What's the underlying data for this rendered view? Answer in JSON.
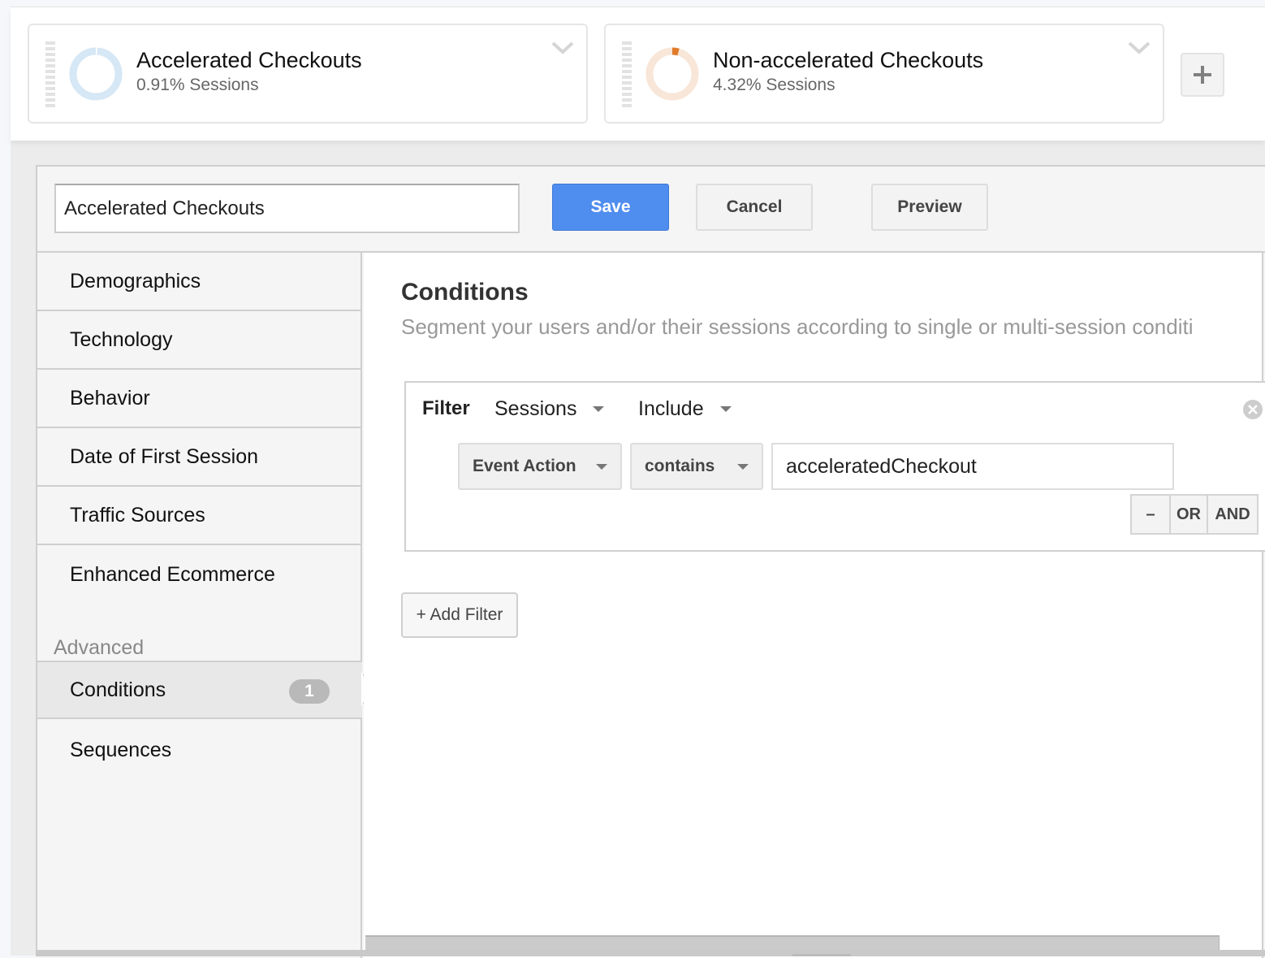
{
  "segments": [
    {
      "title": "Accelerated Checkouts",
      "subtitle": "0.91% Sessions",
      "percent": 0.91,
      "ring_color": "#d6e7f5",
      "fill_color": "#d6e7f5"
    },
    {
      "title": "Non-accelerated Checkouts",
      "subtitle": "4.32% Sessions",
      "percent": 4.32,
      "ring_color": "#f8e6d8",
      "fill_color": "#e07b2a"
    }
  ],
  "add_segment_label": "+",
  "editor": {
    "name_value": "Accelerated Checkouts",
    "save_label": "Save",
    "cancel_label": "Cancel",
    "preview_label": "Preview"
  },
  "sidebar": {
    "items": [
      {
        "label": "Demographics"
      },
      {
        "label": "Technology"
      },
      {
        "label": "Behavior"
      },
      {
        "label": "Date of First Session"
      },
      {
        "label": "Traffic Sources"
      },
      {
        "label": "Enhanced Ecommerce"
      }
    ],
    "advanced_heading": "Advanced",
    "advanced_items": [
      {
        "label": "Conditions",
        "badge": "1",
        "active": true
      },
      {
        "label": "Sequences"
      }
    ]
  },
  "main": {
    "title": "Conditions",
    "description": "Segment your users and/or their sessions according to single or multi-session conditi",
    "filter": {
      "label": "Filter",
      "scope": "Sessions",
      "mode": "Include",
      "dimension": "Event Action",
      "operator": "contains",
      "value": "acceleratedCheckout",
      "minus_label": "–",
      "or_label": "OR",
      "and_label": "AND"
    },
    "add_filter_label": "+ Add Filter"
  },
  "colors": {
    "primary": "#4f8def",
    "accent_orange": "#e07b2a"
  }
}
